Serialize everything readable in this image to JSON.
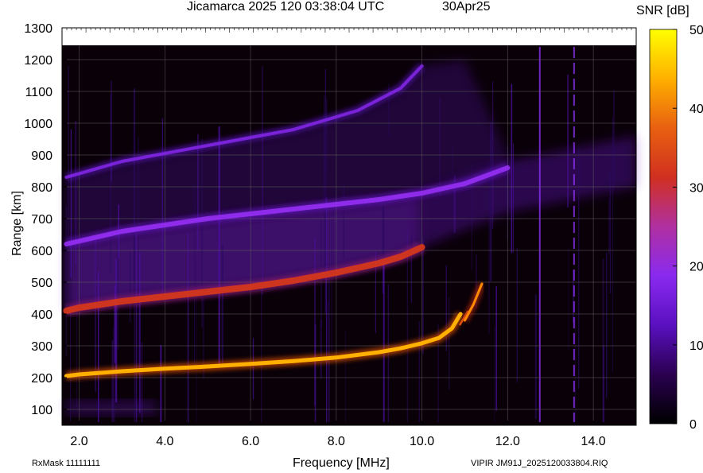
{
  "header": {
    "title": "Jicamarca 2025 120 03:38:04 UTC",
    "date": "30Apr25"
  },
  "footer": {
    "rxmask": "RxMask 11111111",
    "filename": "VIPIR  JM91J_2025120033804.RIQ"
  },
  "colorbar": {
    "title": "SNR [dB]",
    "ticks": [
      "0",
      "10",
      "20",
      "30",
      "40",
      "50"
    ],
    "range": [
      0,
      50
    ],
    "colors": [
      "#000000",
      "#2a0050",
      "#5a10c0",
      "#8a2af0",
      "#b030a0",
      "#d03020",
      "#e86010",
      "#ffb000",
      "#ffff00"
    ]
  },
  "chart_data": {
    "type": "heatmap",
    "title": "Jicamarca 2025 120 03:38:04 UTC",
    "xlabel": "Frequency [MHz]",
    "ylabel": "Range [km]",
    "xlim": [
      1.6,
      15.0
    ],
    "ylim": [
      50,
      1300
    ],
    "xticks": [
      "2.0",
      "4.0",
      "6.0",
      "8.0",
      "10.0",
      "12.0",
      "14.0"
    ],
    "yticks": [
      "100",
      "200",
      "300",
      "400",
      "500",
      "600",
      "700",
      "800",
      "900",
      "1000",
      "1100",
      "1200",
      "1300"
    ],
    "grid": true,
    "series": [
      {
        "x": [
          1.7,
          2.0,
          3.0,
          4.0,
          5.0,
          6.0,
          7.0,
          8.0,
          9.0,
          9.5,
          10.0,
          10.4,
          10.7,
          10.9
        ],
        "y": [
          205,
          210,
          220,
          228,
          235,
          243,
          252,
          263,
          280,
          292,
          308,
          325,
          355,
          400
        ]
      },
      {
        "x": [
          11.0,
          11.2,
          11.4
        ],
        "y": [
          380,
          430,
          495
        ]
      },
      {
        "x": [
          1.7,
          2.0,
          3.0,
          4.0,
          5.0,
          6.0,
          7.0,
          8.0,
          9.0,
          9.5,
          10.0
        ],
        "y": [
          410,
          420,
          440,
          455,
          470,
          485,
          505,
          530,
          560,
          580,
          610
        ]
      },
      {
        "x": [
          1.7,
          3.0,
          5.0,
          7.0,
          9.0,
          10.0,
          11.0,
          12.0
        ],
        "y": [
          620,
          660,
          700,
          730,
          760,
          780,
          810,
          860
        ]
      },
      {
        "x": [
          1.7,
          3.0,
          5.0,
          7.0,
          8.5,
          9.5,
          10.0
        ],
        "y": [
          830,
          880,
          930,
          980,
          1040,
          1110,
          1180
        ]
      }
    ]
  }
}
